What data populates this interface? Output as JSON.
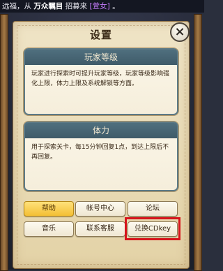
{
  "announcement": {
    "prefix": "远福，从",
    "source": "万众瞩目",
    "middle": "招募来",
    "item": "[萱女]",
    "suffix": "。"
  },
  "dialog": {
    "title": "设置",
    "close_symbol": "×"
  },
  "sections": [
    {
      "heading": "玩家等级",
      "body": "玩家进行探索时可提升玩家等级，玩家等级影响强化上限，体力上限及系统解锁等方面。"
    },
    {
      "heading": "体力",
      "body": "用于探索关卡，每15分钟回复1点，到达上限后不再回复。"
    }
  ],
  "buttons": {
    "help": "帮助",
    "account_center": "帐号中心",
    "forum": "论坛",
    "music": "音乐",
    "contact_support": "联系客服",
    "redeem_cdkey": "兑换CDkey"
  },
  "colors": {
    "paper": "#efe4c6",
    "section_header": "#4f6f7e",
    "active_button": "#f3bf34",
    "highlight": "#d6141b"
  }
}
